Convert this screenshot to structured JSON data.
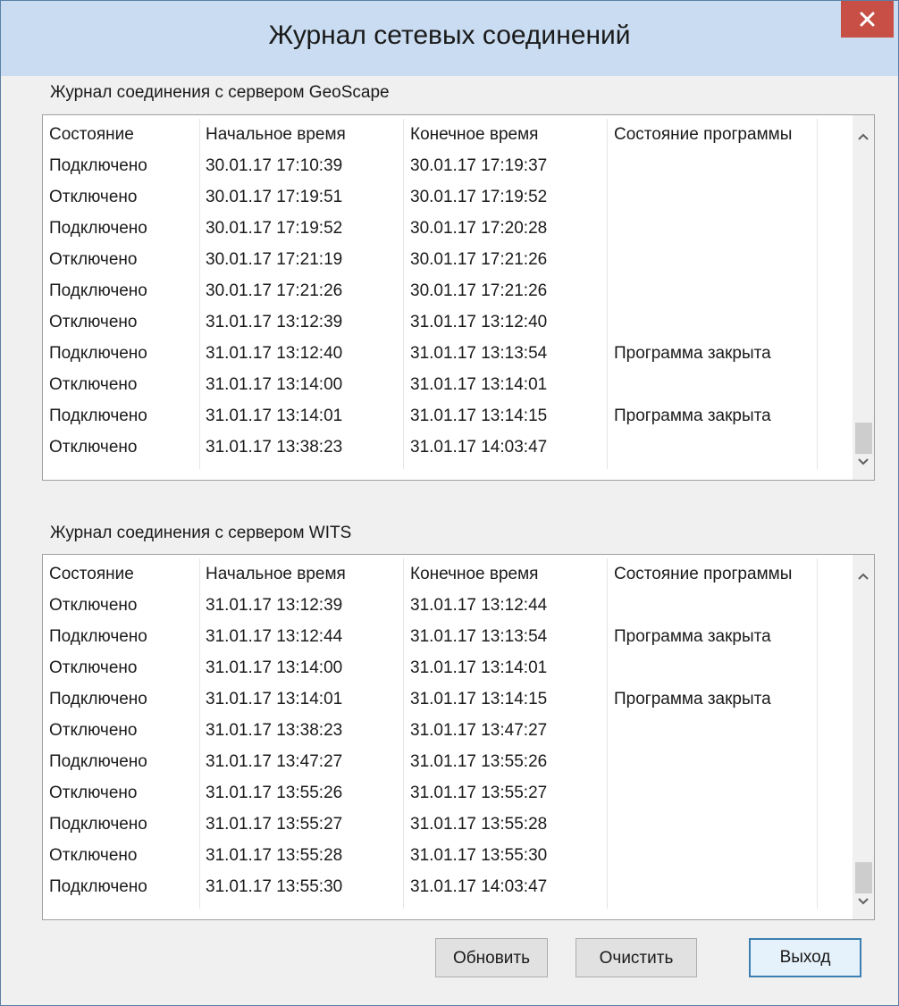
{
  "window": {
    "title": "Журнал сетевых соединений"
  },
  "columns": [
    "Состояние",
    "Начальное время",
    "Конечное время",
    "Состояние программы"
  ],
  "geoscape": {
    "title": "Журнал соединения с сервером GeoScape",
    "rows": [
      [
        "Подключено",
        "30.01.17 17:10:39",
        "30.01.17 17:19:37",
        ""
      ],
      [
        "Отключено",
        "30.01.17 17:19:51",
        "30.01.17 17:19:52",
        ""
      ],
      [
        "Подключено",
        "30.01.17 17:19:52",
        "30.01.17 17:20:28",
        ""
      ],
      [
        "Отключено",
        "30.01.17 17:21:19",
        "30.01.17 17:21:26",
        ""
      ],
      [
        "Подключено",
        "30.01.17 17:21:26",
        "30.01.17 17:21:26",
        ""
      ],
      [
        "Отключено",
        "31.01.17 13:12:39",
        "31.01.17 13:12:40",
        ""
      ],
      [
        "Подключено",
        "31.01.17 13:12:40",
        "31.01.17 13:13:54",
        "Программа закрыта"
      ],
      [
        "Отключено",
        "31.01.17 13:14:00",
        "31.01.17 13:14:01",
        ""
      ],
      [
        "Подключено",
        "31.01.17 13:14:01",
        "31.01.17 13:14:15",
        "Программа закрыта"
      ],
      [
        "Отключено",
        "31.01.17 13:38:23",
        "31.01.17 14:03:47",
        ""
      ]
    ]
  },
  "wits": {
    "title": "Журнал соединения с сервером WITS",
    "rows": [
      [
        "Отключено",
        "31.01.17 13:12:39",
        "31.01.17 13:12:44",
        ""
      ],
      [
        "Подключено",
        "31.01.17 13:12:44",
        "31.01.17 13:13:54",
        "Программа закрыта"
      ],
      [
        "Отключено",
        "31.01.17 13:14:00",
        "31.01.17 13:14:01",
        ""
      ],
      [
        "Подключено",
        "31.01.17 13:14:01",
        "31.01.17 13:14:15",
        "Программа закрыта"
      ],
      [
        "Отключено",
        "31.01.17 13:38:23",
        "31.01.17 13:47:27",
        ""
      ],
      [
        "Подключено",
        "31.01.17 13:47:27",
        "31.01.17 13:55:26",
        ""
      ],
      [
        "Отключено",
        "31.01.17 13:55:26",
        "31.01.17 13:55:27",
        ""
      ],
      [
        "Подключено",
        "31.01.17 13:55:27",
        "31.01.17 13:55:28",
        ""
      ],
      [
        "Отключено",
        "31.01.17 13:55:28",
        "31.01.17 13:55:30",
        ""
      ],
      [
        "Подключено",
        "31.01.17 13:55:30",
        "31.01.17 14:03:47",
        ""
      ]
    ]
  },
  "buttons": {
    "refresh": "Обновить",
    "clear": "Очистить",
    "exit": "Выход"
  },
  "icons": {
    "close": "close-icon",
    "scroll_up": "chevron-up-icon",
    "scroll_down": "chevron-down-icon"
  },
  "colors": {
    "close_button": "#c74f45",
    "titlebar": "#c9dcf1",
    "window_bg": "#f0f0f0"
  }
}
